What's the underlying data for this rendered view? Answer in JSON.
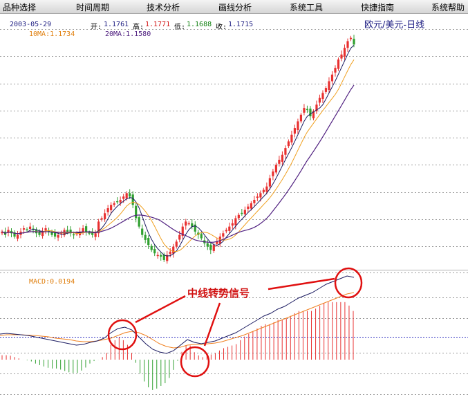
{
  "menu": {
    "items": [
      "品种选择",
      "时间周期",
      "技术分析",
      "画线分析",
      "系统工具",
      "快捷指南",
      "系统帮助"
    ]
  },
  "info": {
    "date": "2003-05-29",
    "open_label": "开:",
    "open": "1.1761",
    "high_label": "高:",
    "high": "1.1771",
    "low_label": "低:",
    "low": "1.1688",
    "close_label": "收:",
    "close": "1.1715",
    "ma10": "10MA:1.1734",
    "ma20": "20MA:1.1580",
    "symbol": "欧元/美元-日线"
  },
  "macd": {
    "label": "MACD:0.0194",
    "annotation": "中线转势信号"
  },
  "colors": {
    "up": "#e83030",
    "down": "#30a030",
    "ma10": "#f0a020",
    "ma20": "#502080",
    "dif": "#1a1a60",
    "dea": "#f08020",
    "grid": "#9a9a9a",
    "zero_line": "#3030c0",
    "circle": "#e01010"
  },
  "chart_data": [
    {
      "type": "candlestick",
      "title": "欧元/美元-日线",
      "last": {
        "date": "2003-05-29",
        "open": 1.1761,
        "high": 1.1771,
        "low": 1.1688,
        "close": 1.1715,
        "ma10": 1.1734,
        "ma20": 1.158
      },
      "series_note": "approximate price path read from the picture, oldest to newest",
      "closes": [
        0.52,
        0.5,
        0.53,
        0.51,
        0.49,
        0.5,
        0.52,
        0.54,
        0.53,
        0.55,
        0.53,
        0.51,
        0.5,
        0.52,
        0.54,
        0.52,
        0.5,
        0.49,
        0.5,
        0.51,
        0.53,
        0.52,
        0.51,
        0.5,
        0.51,
        0.52,
        0.54,
        0.52,
        0.51,
        0.5,
        0.51,
        0.58,
        0.6,
        0.63,
        0.66,
        0.68,
        0.69,
        0.7,
        0.71,
        0.73,
        0.75,
        0.73,
        0.68,
        0.6,
        0.55,
        0.5,
        0.47,
        0.44,
        0.41,
        0.39,
        0.38,
        0.37,
        0.35,
        0.38,
        0.4,
        0.43,
        0.46,
        0.5,
        0.55,
        0.58,
        0.57,
        0.55,
        0.52,
        0.5,
        0.48,
        0.45,
        0.43,
        0.41,
        0.44,
        0.46,
        0.49,
        0.51,
        0.53,
        0.55,
        0.57,
        0.6,
        0.62,
        0.63,
        0.65,
        0.67,
        0.69,
        0.71,
        0.73,
        0.75,
        0.77,
        0.79,
        0.84,
        0.88,
        0.92,
        0.95,
        0.98,
        1.02,
        1.06,
        1.1,
        1.14,
        1.18,
        1.22,
        1.26,
        1.25,
        1.21,
        1.24,
        1.28,
        1.32,
        1.35,
        1.38,
        1.42,
        1.46,
        1.5,
        1.55,
        1.58,
        1.62,
        1.66,
        1.68,
        1.64
      ]
    },
    {
      "type": "line",
      "title": "MACD:0.0194",
      "series": [
        {
          "name": "DIF",
          "values": [
            0.02,
            0.025,
            0.02,
            0.015,
            0.01,
            0.0,
            -0.01,
            -0.02,
            -0.03,
            -0.04,
            -0.05,
            -0.06,
            -0.055,
            -0.04,
            -0.03,
            -0.01,
            0.03,
            0.06,
            0.07,
            0.05,
            0.0,
            -0.05,
            -0.09,
            -0.11,
            -0.12,
            -0.1,
            -0.06,
            -0.02,
            -0.04,
            -0.05,
            -0.04,
            -0.03,
            -0.01,
            0.01,
            0.03,
            0.06,
            0.09,
            0.12,
            0.15,
            0.17,
            0.2,
            0.22,
            0.25,
            0.28,
            0.3,
            0.32,
            0.35,
            0.38,
            0.4,
            0.42,
            0.44,
            0.43
          ]
        },
        {
          "name": "DEA",
          "values": [
            0.01,
            0.015,
            0.015,
            0.015,
            0.012,
            0.01,
            0.005,
            0.0,
            -0.01,
            -0.015,
            -0.02,
            -0.03,
            -0.035,
            -0.035,
            -0.03,
            -0.02,
            -0.01,
            0.01,
            0.03,
            0.04,
            0.03,
            0.01,
            -0.02,
            -0.05,
            -0.07,
            -0.08,
            -0.075,
            -0.06,
            -0.055,
            -0.055,
            -0.05,
            -0.045,
            -0.035,
            -0.02,
            -0.005,
            0.01,
            0.03,
            0.05,
            0.07,
            0.09,
            0.11,
            0.13,
            0.15,
            0.17,
            0.19,
            0.21,
            0.23,
            0.25,
            0.27,
            0.29,
            0.31,
            0.32
          ]
        }
      ]
    }
  ]
}
